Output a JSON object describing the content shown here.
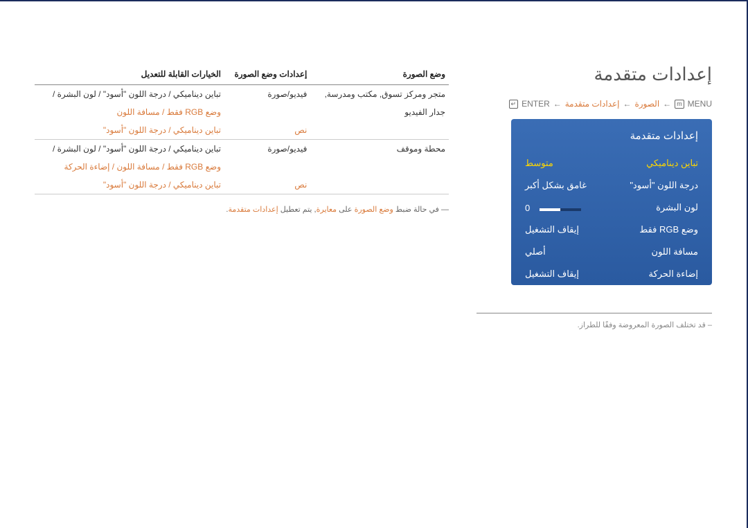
{
  "page_title": "إعدادات متقدمة",
  "breadcrumb": {
    "menu": "MENU",
    "l1": "الصورة",
    "l2": "إعدادات متقدمة",
    "enter": "ENTER",
    "arrow": "←"
  },
  "osd": {
    "title": "إعدادات متقدمة",
    "rows": [
      {
        "label": "تباين ديناميكي",
        "value": "متوسط",
        "selected": true
      },
      {
        "label": "درجة اللون \"أسود\"",
        "value": "غامق بشكل أكبر"
      },
      {
        "label": "لون البشرة",
        "value": "0",
        "slider": true
      },
      {
        "label": "وضع RGB فقط",
        "value": "إيقاف التشغيل"
      },
      {
        "label": "مسافة اللون",
        "value": "أصلي"
      },
      {
        "label": "إضاءة الحركة",
        "value": "إيقاف التشغيل"
      }
    ]
  },
  "table": {
    "headers": [
      "وضع الصورة",
      "إعدادات وضع الصورة",
      "الخيارات القابلة للتعديل"
    ],
    "rows": [
      {
        "c0": "متجر ومركز تسوق, مكتب ومدرسة,",
        "c1": "فيديو/صورة",
        "c2": "تباين ديناميكي / درجة اللون \"أسود\" / لون البشرة /",
        "orange": false
      },
      {
        "c0": "جدار الفيديو",
        "c1": "",
        "c2": "وضع RGB فقط / مسافة اللون",
        "orange": true
      },
      {
        "c0": "",
        "c1": "نص",
        "c2": "تباين ديناميكي / درجة اللون \"أسود\"",
        "orange": true,
        "nc1": true
      },
      {
        "c0": "محطة وموقف",
        "c1": "فيديو/صورة",
        "c2": "تباين ديناميكي / درجة اللون \"أسود\" / لون البشرة /",
        "orange": false
      },
      {
        "c0": "",
        "c1": "",
        "c2": "وضع RGB فقط / مسافة اللون / إضاءة الحركة",
        "orange": true
      },
      {
        "c0": "",
        "c1": "نص",
        "c2": "تباين ديناميكي / درجة اللون \"أسود\"",
        "orange": true,
        "nc1": true
      }
    ]
  },
  "footnote": {
    "pre": "― في حالة ضبط ",
    "o1": "وضع الصورة",
    "mid": " على ",
    "o2": "معايرة",
    "post": ", يتم تعطيل ",
    "o3": "إعدادات متقدمة",
    "end": "."
  },
  "note": "– قد تختلف الصورة المعروضة وفقًا للطراز."
}
